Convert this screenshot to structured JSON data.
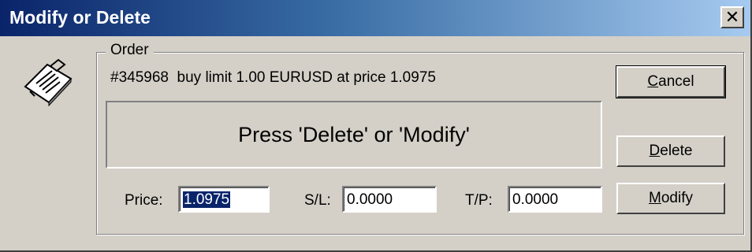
{
  "window": {
    "title": "Modify or Delete",
    "close_glyph": "✕"
  },
  "icon": "order-ticket-icon",
  "order": {
    "group_label": "Order",
    "description": "#345968  buy limit 1.00 EURUSD at price 1.0975"
  },
  "message": "Press 'Delete' or 'Modify'",
  "fields": {
    "price_label": "Price:",
    "price_value": "1.0975",
    "sl_label": "S/L:",
    "sl_value": "0.0000",
    "tp_label": "T/P:",
    "tp_value": "0.0000"
  },
  "buttons": {
    "cancel_mnemonic": "C",
    "cancel_rest": "ancel",
    "delete_mnemonic": "D",
    "delete_rest": "elete",
    "modify_mnemonic": "M",
    "modify_rest": "odify"
  },
  "colors": {
    "title_bar_start": "#0a246a",
    "title_bar_end": "#a6caf0",
    "face": "#d4d0c8",
    "selection": "#0a246a"
  }
}
